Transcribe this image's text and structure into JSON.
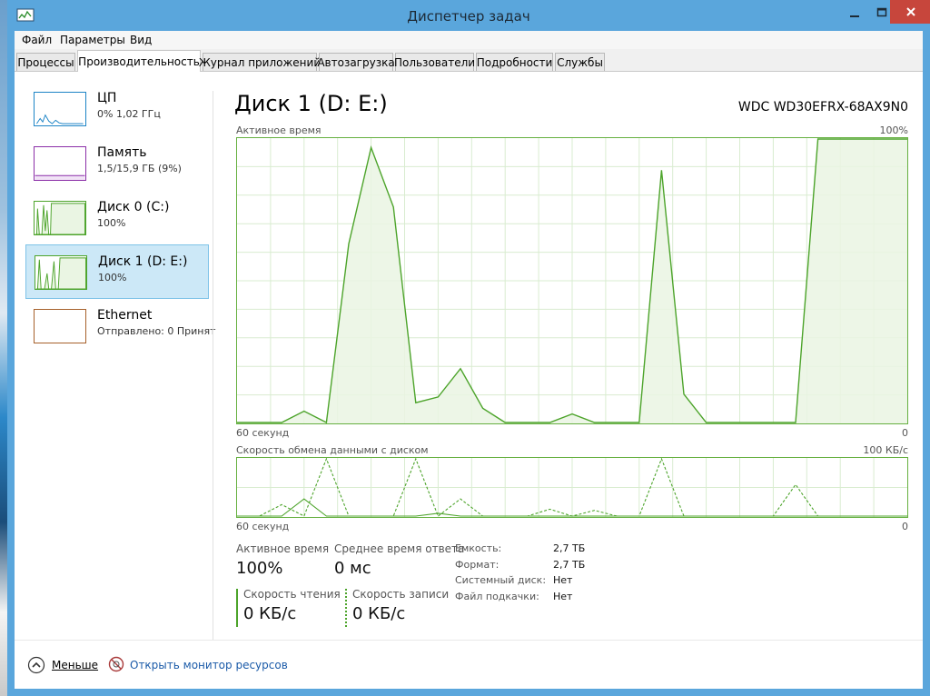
{
  "window": {
    "title": "Диспетчер задач"
  },
  "menu": [
    "Файл",
    "Параметры",
    "Вид"
  ],
  "tabs": [
    {
      "label": "Процессы"
    },
    {
      "label": "Производительность",
      "active": true
    },
    {
      "label": "Журнал приложений"
    },
    {
      "label": "Автозагрузка"
    },
    {
      "label": "Пользователи"
    },
    {
      "label": "Подробности"
    },
    {
      "label": "Службы"
    }
  ],
  "sidebar": {
    "items": [
      {
        "name": "ЦП",
        "sub": "0% 1,02 ГГц",
        "color": "#1c84c6"
      },
      {
        "name": "Память",
        "sub": "1,5/15,9 ГБ (9%)",
        "color": "#8b2fa8"
      },
      {
        "name": "Диск 0 (C:)",
        "sub": "100%",
        "color": "#4da42b"
      },
      {
        "name": "Диск 1 (D: E:)",
        "sub": "100%",
        "color": "#4da42b",
        "selected": true
      },
      {
        "name": "Ethernet",
        "sub": "Отправлено: 0 Принят",
        "color": "#a6602a"
      }
    ]
  },
  "main": {
    "title": "Диск 1 (D: E:)",
    "model": "WDC WD30EFRX-68AX9N0",
    "graph1": {
      "label": "Активное время",
      "max_label": "100%",
      "time_label": "60 секунд",
      "min_label": "0"
    },
    "graph2": {
      "label": "Скорость обмена данными с диском",
      "max_label": "100 КБ/с",
      "time_label": "60 секунд",
      "min_label": "0"
    },
    "stats": {
      "active_time_label": "Активное время",
      "active_time_value": "100%",
      "response_label": "Среднее время ответа",
      "response_value": "0 мс",
      "read_label": "Скорость чтения",
      "read_value": "0 КБ/с",
      "write_label": "Скорость записи",
      "write_value": "0 КБ/с"
    },
    "props": [
      {
        "label": "Емкость:",
        "value": "2,7 ТБ"
      },
      {
        "label": "Формат:",
        "value": "2,7 ТБ"
      },
      {
        "label": "Системный диск:",
        "value": "Нет"
      },
      {
        "label": "Файл подкачки:",
        "value": "Нет"
      }
    ]
  },
  "footer": {
    "less_label": "Меньше",
    "monitor_label": "Открыть монитор ресурсов"
  },
  "colors": {
    "disk_line": "#4da42b",
    "disk_fill": "#eaf5e3",
    "grid": "#d9ecd0",
    "titlebar": "#5aa6dc",
    "close": "#c7463c",
    "selected_bg": "#cce8f7",
    "link": "#1a5aa8"
  },
  "chart_data": [
    {
      "type": "area",
      "title": "Активное время",
      "xlabel": "60 секунд",
      "ylabel": "",
      "x": [
        0,
        2,
        4,
        6,
        8,
        10,
        12,
        14,
        16,
        18,
        20,
        22,
        24,
        26,
        28,
        30,
        32,
        34,
        36,
        38,
        40,
        42,
        44,
        46,
        48,
        50,
        52,
        54,
        56,
        58,
        60
      ],
      "series": [
        {
          "values": [
            0,
            0,
            0,
            4,
            0,
            63,
            97,
            76,
            7,
            9,
            19,
            5,
            0,
            0,
            0,
            3,
            0,
            0,
            0,
            89,
            10,
            0,
            0,
            0,
            0,
            0,
            100,
            100,
            100,
            100,
            100
          ]
        }
      ],
      "ylim": [
        0,
        100
      ],
      "grid": true
    },
    {
      "type": "line",
      "title": "Скорость обмена данными с диском",
      "xlabel": "60 секунд",
      "ylabel": "",
      "x": [
        0,
        2,
        4,
        6,
        8,
        10,
        12,
        14,
        16,
        18,
        20,
        22,
        24,
        26,
        28,
        30,
        32,
        34,
        36,
        38,
        40,
        42,
        44,
        46,
        48,
        50,
        52,
        54,
        56,
        58,
        60
      ],
      "series": [
        {
          "values": [
            0,
            0,
            20,
            0,
            100,
            0,
            0,
            0,
            100,
            0,
            30,
            0,
            0,
            0,
            12,
            0,
            10,
            0,
            0,
            100,
            0,
            0,
            0,
            0,
            0,
            55,
            0,
            0,
            0,
            0,
            0
          ]
        },
        {
          "values": [
            0,
            0,
            0,
            30,
            0,
            0,
            0,
            0,
            0,
            5,
            0,
            0,
            0,
            0,
            0,
            0,
            0,
            0,
            0,
            0,
            0,
            0,
            0,
            0,
            0,
            0,
            0,
            0,
            0,
            0,
            0
          ]
        }
      ],
      "ylim": [
        0,
        100
      ],
      "grid": true
    }
  ]
}
